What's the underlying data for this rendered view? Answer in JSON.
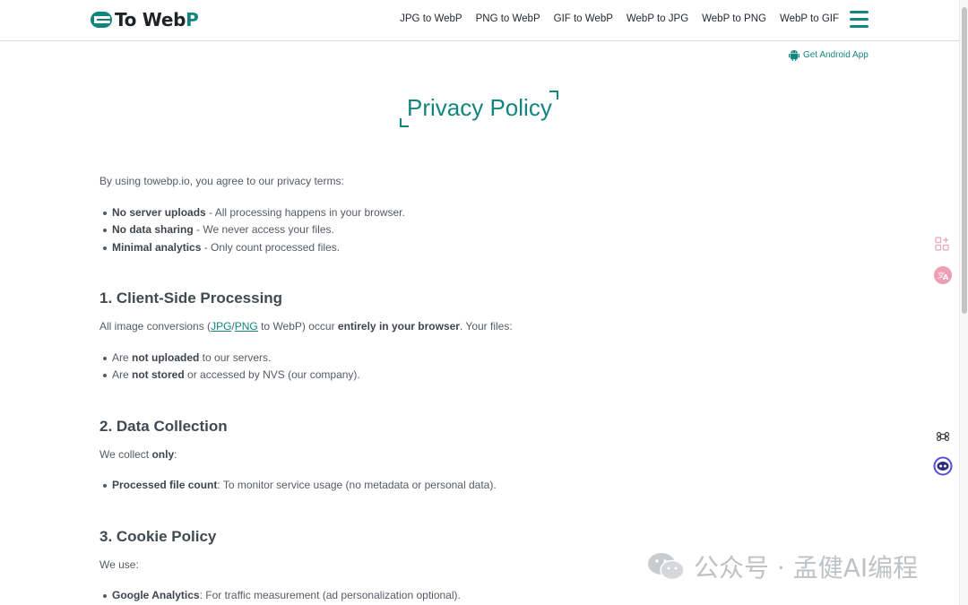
{
  "header": {
    "logo_text_main": "To Web",
    "logo_text_accent": "P",
    "nav": [
      "JPG to WebP",
      "PNG to WebP",
      "GIF to WebP",
      "WebP to JPG",
      "WebP to PNG",
      "WebP to GIF"
    ],
    "menu_icon": "hamburger-icon"
  },
  "android_link": {
    "label": "Get Android App",
    "icon": "android-icon"
  },
  "page_title": "Privacy Policy",
  "intro": "By using towebp.io, you agree to our privacy terms:",
  "summary": [
    {
      "bold": "No server uploads",
      "text": " - All processing happens in your browser."
    },
    {
      "bold": "No data sharing",
      "text": " - We never access your files."
    },
    {
      "bold": "Minimal analytics",
      "text": " - Only count processed files."
    }
  ],
  "section1": {
    "heading": "1. Client-Side Processing",
    "para_pre": "All image conversions (",
    "link1": "JPG",
    "slash": "/",
    "link2": "PNG",
    "para_mid": " to WebP) occur ",
    "para_bold": "entirely in your browser",
    "para_post": ". Your files:",
    "items": [
      {
        "pre": "Are ",
        "bold": "not uploaded",
        "post": " to our servers."
      },
      {
        "pre": "Are ",
        "bold": "not stored",
        "post": " or accessed by NVS (our company)."
      }
    ]
  },
  "section2": {
    "heading": "2. Data Collection",
    "para_pre": "We collect ",
    "para_bold": "only",
    "para_post": ":",
    "items": [
      {
        "bold": "Processed file count",
        "text": ": To monitor service usage (no metadata or personal data)."
      }
    ]
  },
  "section3": {
    "heading": "3. Cookie Policy",
    "para": "We use:",
    "items": [
      {
        "bold": "Google Analytics",
        "text": ": For traffic measurement (ad personalization optional)."
      }
    ]
  },
  "side_widgets": [
    "apps-grid-icon",
    "translate-icon",
    "command-icon",
    "assistant-icon"
  ],
  "watermark": "公众号 · 孟健AI编程",
  "colors": {
    "brand": "#13857f",
    "text": "#555b63",
    "heading": "#3f4a52"
  }
}
